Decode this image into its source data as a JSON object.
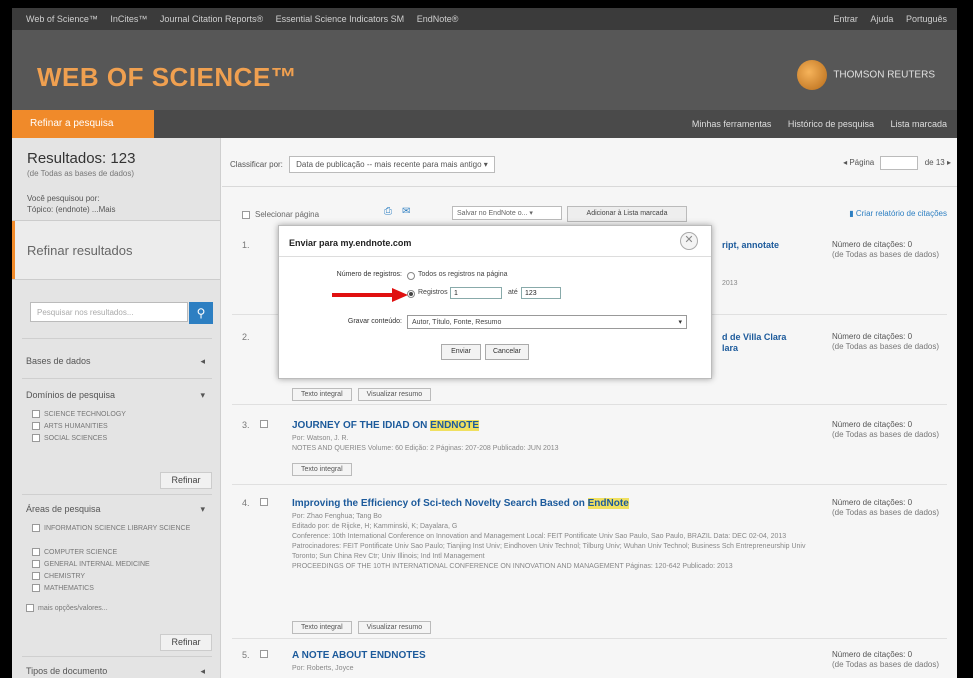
{
  "topbar": {
    "left": [
      "Web of Science™",
      "InCites™",
      "Journal Citation Reports®",
      "Essential Science Indicators SM",
      "EndNote®"
    ],
    "right": [
      "Entrar",
      "Ajuda",
      "Português"
    ]
  },
  "header": {
    "logo": "WEB OF SCIENCE™",
    "brand": "THOMSON REUTERS"
  },
  "subbar": {
    "refine_tab": "Refinar a pesquisa",
    "nav": [
      "Minhas ferramentas",
      "Histórico de pesquisa",
      "Lista marcada"
    ]
  },
  "sidebar": {
    "results": "Resultados: 123",
    "results_sub": "(de Todas as bases de dados)",
    "search_note_1": "Você pesquisou por:",
    "search_note_2": "Tópico: (endnote) ...Mais",
    "refine_title": "Refinar resultados",
    "search_placeholder": "Pesquisar nos resultados...",
    "sections": [
      {
        "label": "Bases de dados"
      },
      {
        "label": "Domínios de pesquisa"
      },
      {
        "label": "Áreas de pesquisa"
      },
      {
        "label": "Tipos de documento"
      }
    ],
    "domains": [
      "SCIENCE TECHNOLOGY",
      "ARTS HUMANITIES",
      "SOCIAL SCIENCES"
    ],
    "areas": [
      "INFORMATION SCIENCE LIBRARY SCIENCE",
      "COMPUTER SCIENCE",
      "GENERAL INTERNAL MEDICINE",
      "CHEMISTRY",
      "MATHEMATICS"
    ],
    "more": "mais opções/valores...",
    "refine_btn": "Refinar"
  },
  "main": {
    "sort_label": "Classificar por:",
    "sort_value": "Data de publicação -- mais recente para mais antigo",
    "pager_label": "Página",
    "pager_of": "de 13",
    "select_page": "Selecionar página",
    "endnote_dd": "Salvar no EndNote o...",
    "add_marked": "Adicionar à Lista marcada",
    "citation_report": "Criar relatório de citações",
    "records": [
      {
        "num": "1.",
        "title_frag": "ript, annotate",
        "meta_frag": "2013",
        "cit": "Número de citações: 0",
        "cit_sub": "(de Todas as bases de dados)"
      },
      {
        "num": "2.",
        "title_frag": "d de Villa Clara",
        "title_frag2": "lara",
        "cit": "Número de citações: 0",
        "cit_sub": "(de Todas as bases de dados)",
        "btn1": "Texto integral",
        "btn2": "Visualizar resumo"
      },
      {
        "num": "3.",
        "title": "JOURNEY OF THE IDIAD ON",
        "title_hl": "ENDNOTE",
        "meta1": "Por: Watson, J. R.",
        "meta2": "NOTES AND QUERIES  Volume: 60  Edição: 2  Páginas: 207-208  Publicado: JUN 2013",
        "btn1": "Texto integral",
        "cit": "Número de citações: 0",
        "cit_sub": "(de Todas as bases de dados)"
      },
      {
        "num": "4.",
        "title": "Improving the Efficiency of Sci-tech Novelty Search Based on",
        "title_hl": "EndNote",
        "meta1": "Por: Zhao Fenghua; Tang Bo",
        "meta2": "Editado por: de Rijcke, H; Kamminski, K; Dayalara, G",
        "meta3": "Conference: 10th International Conference on Innovation and Management Local: FEIT Pontificate Univ Sao Paulo, Sao Paulo, BRAZIL Data: DEC 02-04, 2013",
        "meta4": "Patrocinadores: FEIT Pontificate Univ Sao Paulo; Tianjing Inst Univ; Eindhoven Univ Technol; Tilburg Univ; Wuhan Univ Technol; Business Sch Entrepreneurship Univ Toronto; Sun China Rev Ctr; Univ Illinois; Ind Intl Management",
        "meta5": "PROCEEDINGS OF THE 10TH INTERNATIONAL CONFERENCE ON INNOVATION AND MANAGEMENT  Páginas: 120-642  Publicado: 2013",
        "btn1": "Texto integral",
        "btn2": "Visualizar resumo",
        "cit": "Número de citações: 0",
        "cit_sub": "(de Todas as bases de dados)"
      },
      {
        "num": "5.",
        "title": "A NOTE ABOUT ENDNOTES",
        "meta1": "Por: Roberts, Joyce",
        "cit": "Número de citações: 0",
        "cit_sub": "(de Todas as bases de dados)"
      }
    ]
  },
  "dialog": {
    "title": "Enviar para my.endnote.com",
    "records_label": "Número de registros:",
    "all_option": "Todos os registros na página",
    "records_option": "Registros",
    "from_value": "1",
    "to_label": "até",
    "to_value": "123",
    "content_label": "Gravar conteúdo:",
    "content_value": "Autor, Título, Fonte, Resumo",
    "send_btn": "Enviar",
    "cancel_btn": "Cancelar"
  },
  "colors": {
    "accent": "#f08a2a",
    "link": "#1c5a9b",
    "arrow": "#e01010"
  }
}
